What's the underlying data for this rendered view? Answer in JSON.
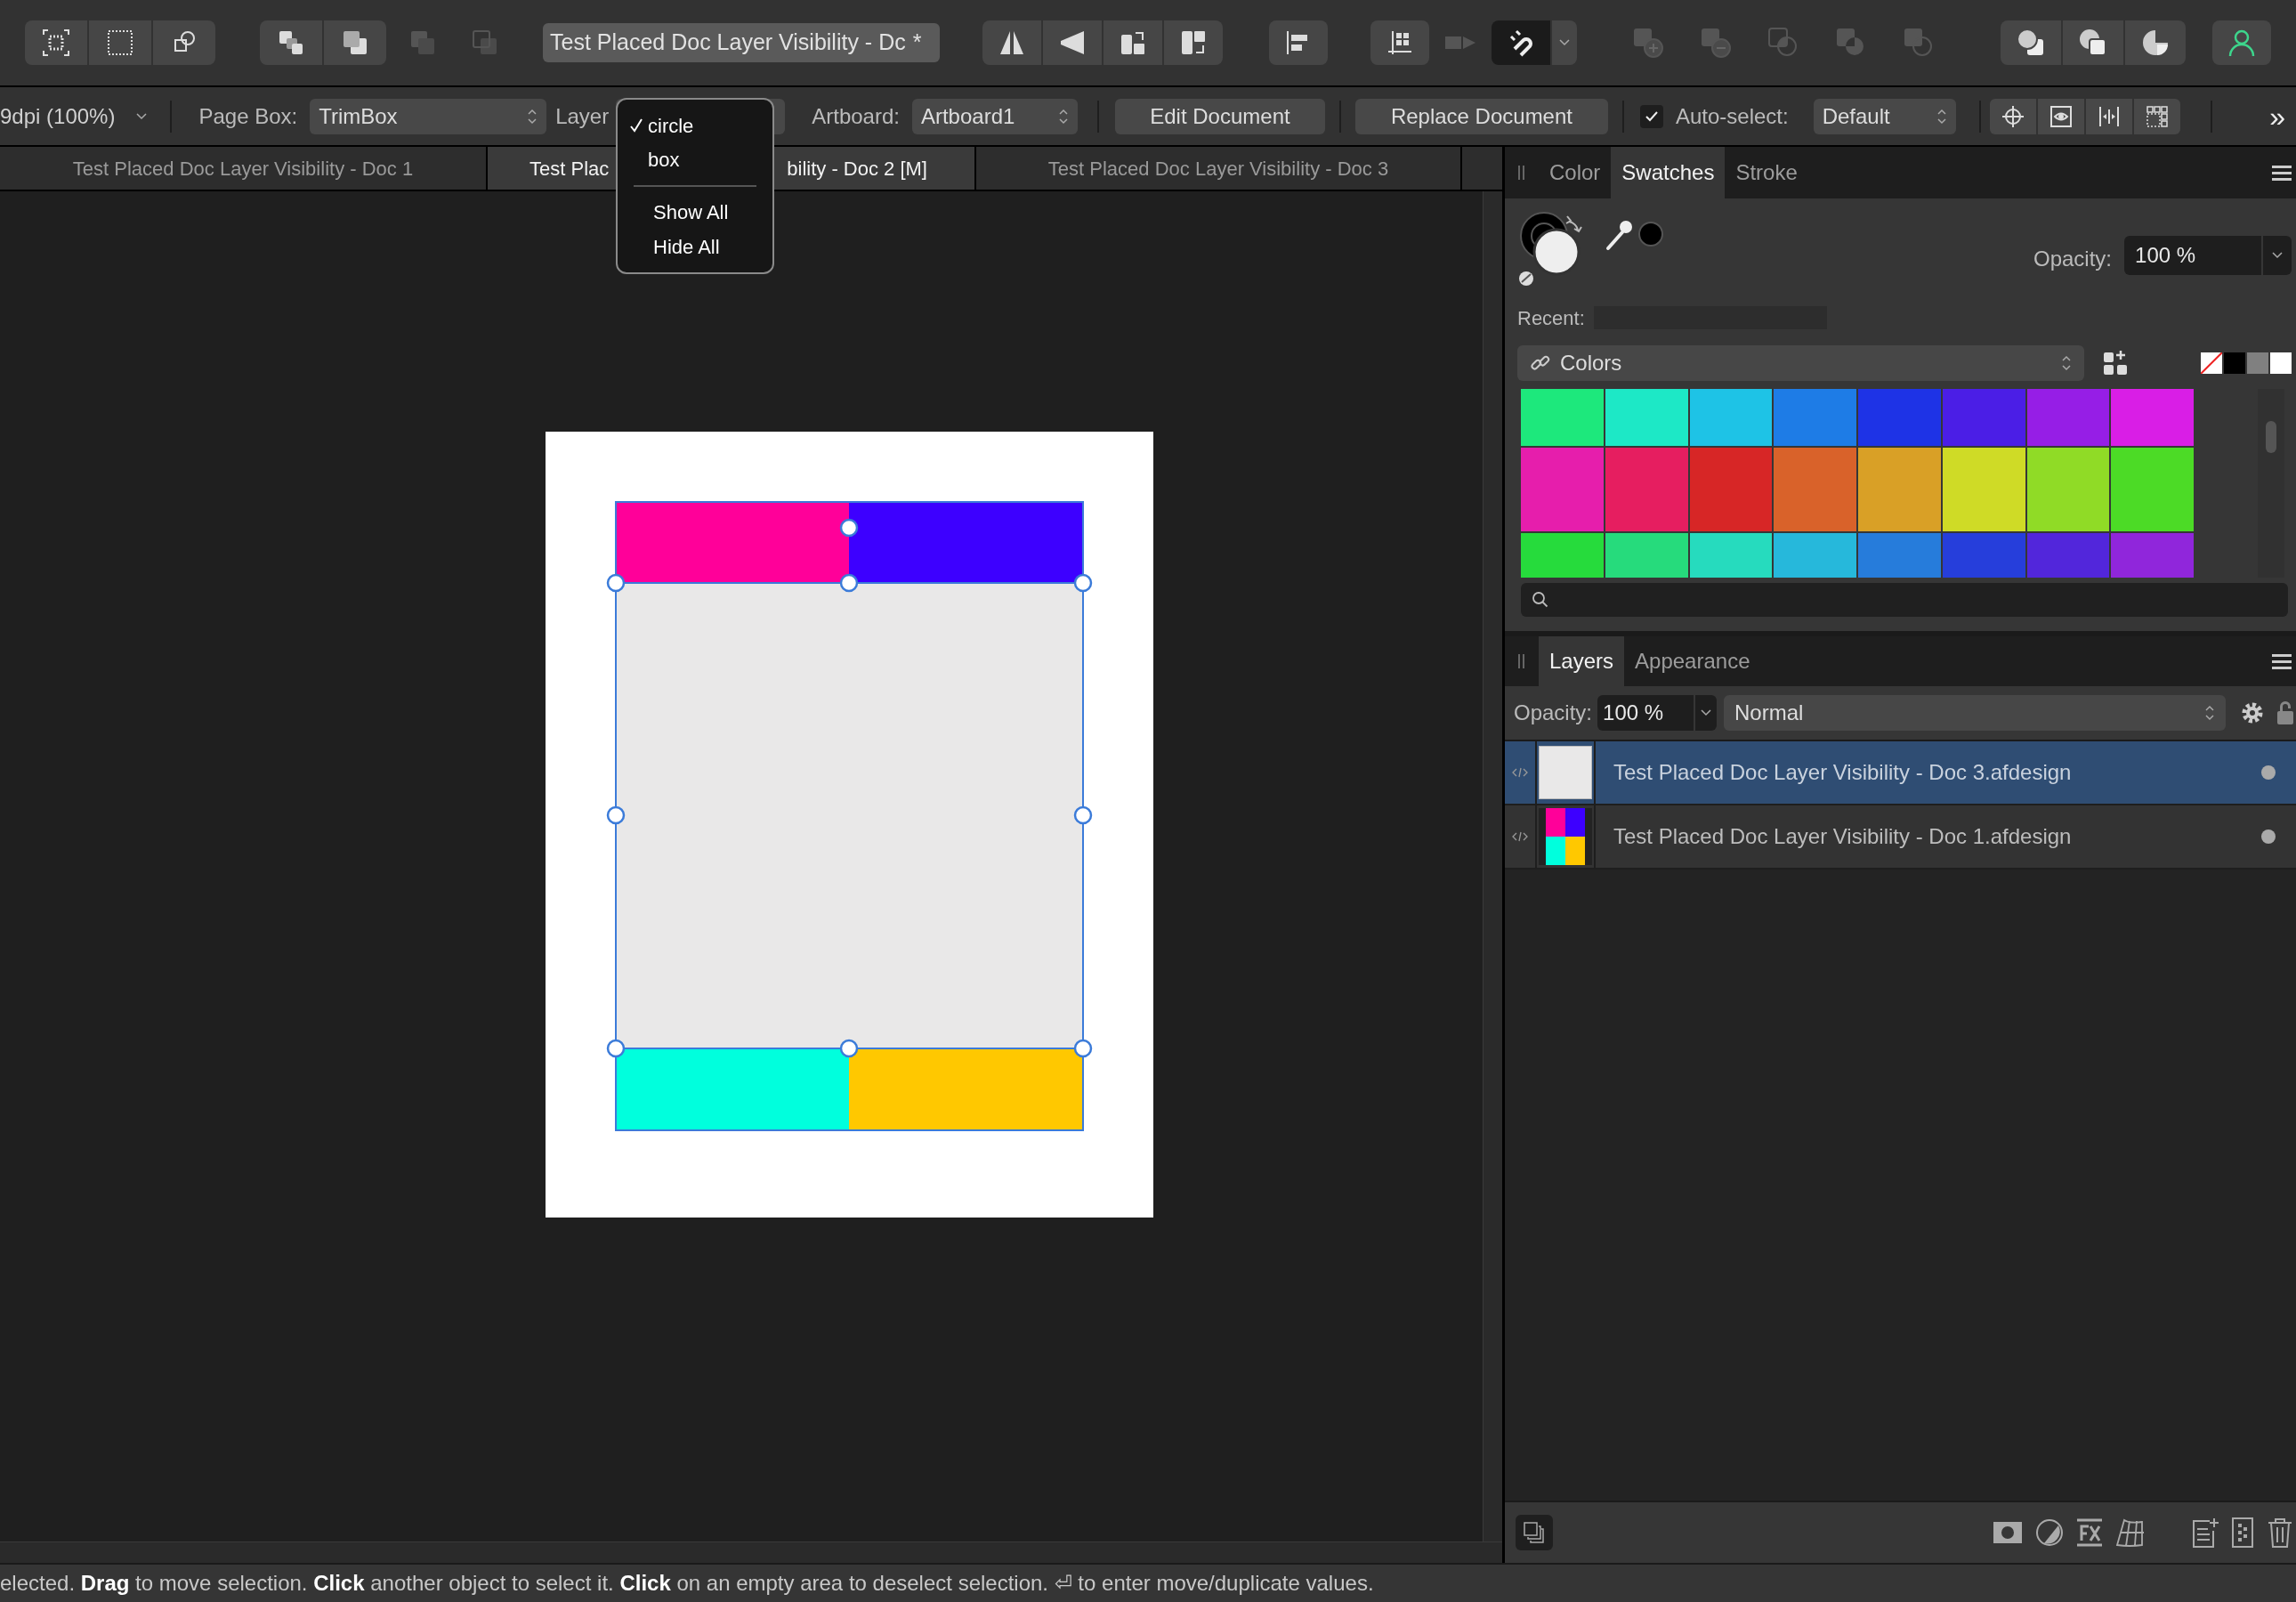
{
  "toolbar": {
    "document_title": "Test Placed Doc Layer Visibility - Dc",
    "modified_mark": "*"
  },
  "context_bar": {
    "dpi": "9dpi (100%)",
    "page_box_label": "Page Box:",
    "page_box": "TrimBox",
    "layer_label": "Layer",
    "artboard_label": "Artboard:",
    "artboard": "Artboard1",
    "buttons": [
      "Edit Document",
      "Replace Document"
    ],
    "auto_select": {
      "checked": true,
      "label": "Auto-select:",
      "value": "Default"
    },
    "overflow": "»"
  },
  "document_tabs": [
    {
      "label_parts": [
        "Test Placed Doc Layer Visibility - Doc 1"
      ],
      "selected": false
    },
    {
      "label_parts": [
        "Test Plac",
        "bility - Doc 2 [M]"
      ],
      "selected": true
    },
    {
      "label_parts": [
        "Test Placed Doc Layer Visibility - Doc 3"
      ],
      "selected": false
    }
  ],
  "layer_menu": {
    "items": [
      {
        "label": "circle",
        "checked": true
      },
      {
        "label": "box",
        "checked": false
      }
    ],
    "actions": [
      "Show All",
      "Hide All"
    ]
  },
  "color_panel": {
    "tabs": [
      {
        "label": "Color",
        "selected": false
      },
      {
        "label": "Swatches",
        "selected": true
      },
      {
        "label": "Stroke",
        "selected": false
      }
    ],
    "opacity_label": "Opacity:",
    "opacity": "100 %",
    "recent_label": "Recent:",
    "palette": "Colors",
    "swatches": [
      {
        "color": "#1de87c"
      },
      {
        "color": "#1de8c6"
      },
      {
        "color": "#1ec3e6"
      },
      {
        "color": "#1e7ce6"
      },
      {
        "color": "#1e33e6"
      },
      {
        "color": "#4b1ee6"
      },
      {
        "color": "#961ee6"
      },
      {
        "color": "#d91ee6"
      },
      {
        "color": "#e61eac"
      },
      {
        "color": "#e61e60"
      },
      {
        "color": "#d72626"
      },
      {
        "color": "#d9622a"
      },
      {
        "color": "#d9a026"
      },
      {
        "color": "#cfdb26"
      },
      {
        "color": "#90db26"
      },
      {
        "color": "#4cdb26"
      },
      {
        "color": "#26db3c"
      },
      {
        "color": "#26db7c"
      },
      {
        "color": "#26dbbe"
      },
      {
        "color": "#26b8db"
      },
      {
        "color": "#267cdb"
      },
      {
        "color": "#263edb"
      },
      {
        "color": "#5226db"
      },
      {
        "color": "#9026db"
      }
    ]
  },
  "layers_panel": {
    "tabs": [
      {
        "label": "Layers",
        "selected": true
      },
      {
        "label": "Appearance",
        "selected": false
      }
    ],
    "opacity_label": "Opacity:",
    "opacity": "100 %",
    "blend_mode": "Normal",
    "layers": [
      {
        "name": "Test Placed Doc Layer Visibility - Doc 3.afdesign",
        "selected": true,
        "kind": "plain"
      },
      {
        "name": "Test Placed Doc Layer Visibility - Doc 1.afdesign",
        "selected": false,
        "kind": "quadrants"
      }
    ]
  },
  "status_bar": {
    "text": "elected. **Drag** to move selection. **Click** another object to select it. **Click** on an empty area to deselect selection. ⏎ to enter move/duplicate values."
  }
}
